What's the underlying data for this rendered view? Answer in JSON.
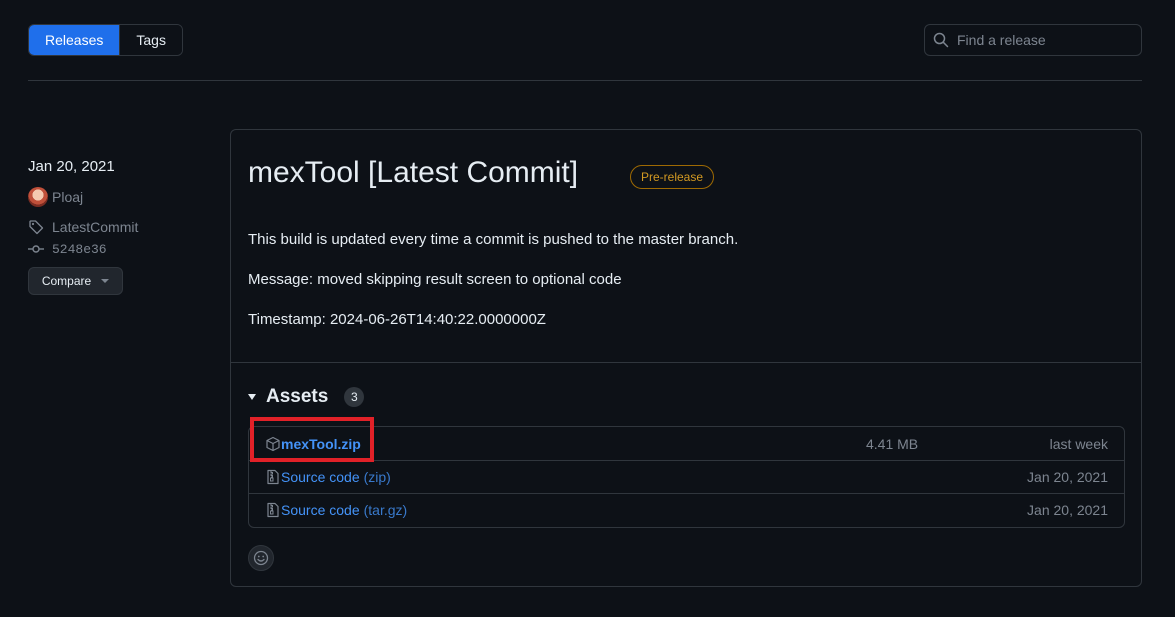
{
  "top_bar": {
    "tabs": [
      {
        "label": "Releases",
        "active": true
      },
      {
        "label": "Tags",
        "active": false
      }
    ],
    "search": {
      "placeholder": "Find a release",
      "value": ""
    }
  },
  "sidebar": {
    "date": "Jan 20, 2021",
    "author": "Ploaj",
    "tag": "LatestCommit",
    "commit": "5248e36",
    "compare_label": "Compare"
  },
  "release": {
    "title": "mexTool [Latest Commit]",
    "badge": "Pre-release",
    "description": [
      "This build is updated every time a commit is pushed to the master branch.",
      "Message: moved skipping result screen to optional code",
      "Timestamp: 2024-06-26T14:40:22.0000000Z"
    ],
    "assets_label": "Assets",
    "assets_count": "3",
    "assets": [
      {
        "name": "mexTool.zip",
        "suffix": "",
        "size": "4.41 MB",
        "date": "last week",
        "icon": "package-icon"
      },
      {
        "name": "Source code",
        "suffix": "(zip)",
        "size": "",
        "date": "Jan 20, 2021",
        "icon": "file-zip-icon"
      },
      {
        "name": "Source code",
        "suffix": "(tar.gz)",
        "size": "",
        "date": "Jan 20, 2021",
        "icon": "file-zip-icon"
      }
    ]
  },
  "colors": {
    "accent": "#1f6feb",
    "link": "#4493f8",
    "prerelease": "#d29922",
    "highlight": "#e12128",
    "background": "#0d1117"
  }
}
